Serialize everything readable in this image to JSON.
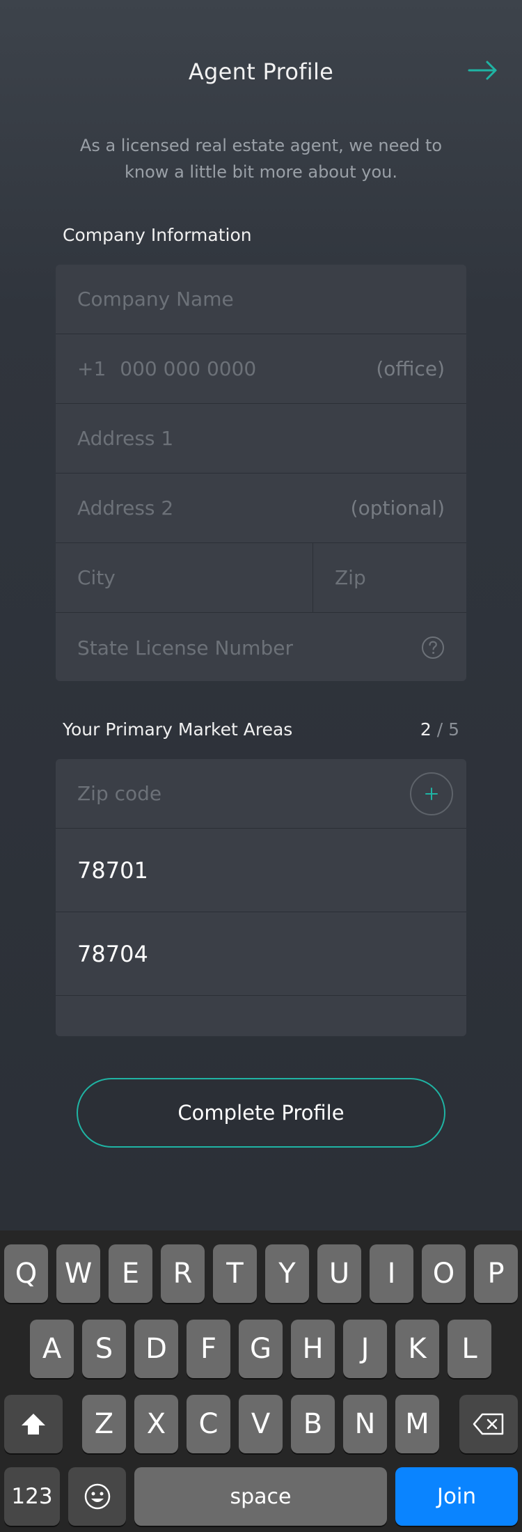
{
  "header": {
    "title": "Agent Profile",
    "subtitle": "As a licensed real estate agent, we need to know a little bit more about you.",
    "next_icon": "arrow-right-icon"
  },
  "company": {
    "section_label": "Company Information",
    "company_name_placeholder": "Company Name",
    "phone_prefix": "+1",
    "phone_placeholder": "000 000 0000",
    "phone_suffix": "(office)",
    "address1_placeholder": "Address 1",
    "address2_placeholder": "Address 2",
    "address2_suffix": "(optional)",
    "city_placeholder": "City",
    "zip_placeholder": "Zip",
    "license_placeholder": "State License Number",
    "help_icon": "question-circle-icon"
  },
  "market": {
    "section_label": "Your Primary Market Areas",
    "count_current": "2",
    "count_separator": "/",
    "count_total": "5",
    "zip_input_placeholder": "Zip code",
    "add_icon": "plus-circle-icon",
    "zips": [
      "78701",
      "78704"
    ]
  },
  "actions": {
    "complete_label": "Complete Profile"
  },
  "keyboard": {
    "row1": [
      "Q",
      "W",
      "E",
      "R",
      "T",
      "Y",
      "U",
      "I",
      "O",
      "P"
    ],
    "row2": [
      "A",
      "S",
      "D",
      "F",
      "G",
      "H",
      "J",
      "K",
      "L"
    ],
    "row3": [
      "Z",
      "X",
      "C",
      "V",
      "B",
      "N",
      "M"
    ],
    "numbers_label": "123",
    "space_label": "space",
    "join_label": "Join",
    "shift_icon": "shift-icon",
    "delete_icon": "backspace-icon",
    "emoji_icon": "emoji-icon"
  },
  "colors": {
    "accent": "#1fb4a4",
    "join_blue": "#0a84ff"
  }
}
